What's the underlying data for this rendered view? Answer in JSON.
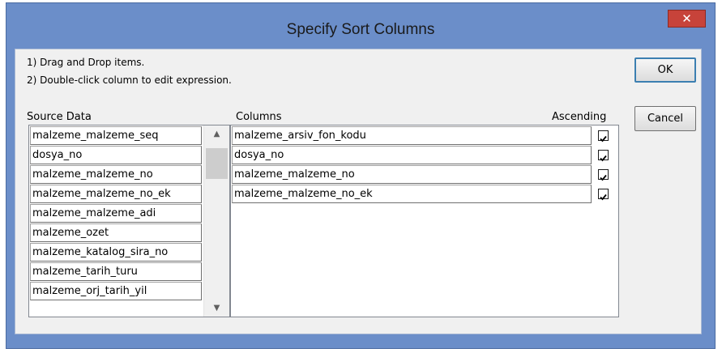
{
  "window": {
    "title": "Specify Sort Columns",
    "close_glyph": "✕"
  },
  "instructions": [
    "1) Drag and Drop items.",
    "2) Double-click column to edit expression."
  ],
  "buttons": {
    "ok_label": "OK",
    "cancel_label": "Cancel"
  },
  "source": {
    "label": "Source Data",
    "items": [
      "malzeme_malzeme_seq",
      "dosya_no",
      "malzeme_malzeme_no",
      "malzeme_malzeme_no_ek",
      "malzeme_malzeme_adi",
      "malzeme_ozet",
      "malzeme_katalog_sira_no",
      "malzeme_tarih_turu",
      "malzeme_orj_tarih_yil"
    ],
    "scroll_up_icon": "chevron-up-icon",
    "scroll_down_icon": "chevron-down-icon"
  },
  "columns": {
    "label": "Columns",
    "ascending_label": "Ascending",
    "items": [
      {
        "name": "malzeme_arsiv_fon_kodu",
        "ascending": true
      },
      {
        "name": "dosya_no",
        "ascending": true
      },
      {
        "name": "malzeme_malzeme_no",
        "ascending": true
      },
      {
        "name": "malzeme_malzeme_no_ek",
        "ascending": true
      }
    ]
  },
  "colors": {
    "titlebar": "#6b8ec9",
    "close_button": "#c7433a",
    "dialog_body": "#f0f0f0"
  }
}
